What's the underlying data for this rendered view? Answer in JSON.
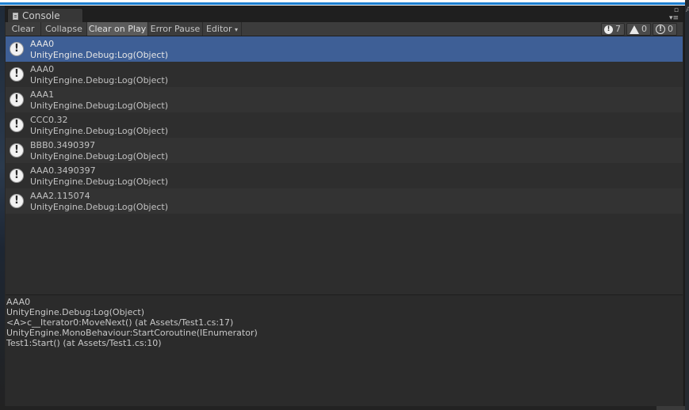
{
  "window": {
    "tab_title": "Console",
    "top_right_char": "A"
  },
  "toolbar": {
    "clear": "Clear",
    "collapse": "Collapse",
    "clear_on_play": "Clear on Play",
    "error_pause": "Error Pause",
    "editor": "Editor",
    "editor_arrow": "▾",
    "counts": {
      "errors": "7",
      "warnings": "0",
      "infos": "0"
    }
  },
  "log_entries": [
    {
      "message": "AAA0",
      "source": "UnityEngine.Debug:Log(Object)"
    },
    {
      "message": "AAA0",
      "source": "UnityEngine.Debug:Log(Object)"
    },
    {
      "message": "AAA1",
      "source": "UnityEngine.Debug:Log(Object)"
    },
    {
      "message": "CCC0.32",
      "source": "UnityEngine.Debug:Log(Object)"
    },
    {
      "message": "BBB0.3490397",
      "source": "UnityEngine.Debug:Log(Object)"
    },
    {
      "message": "AAA0.3490397",
      "source": "UnityEngine.Debug:Log(Object)"
    },
    {
      "message": "AAA2.115074",
      "source": "UnityEngine.Debug:Log(Object)"
    }
  ],
  "detail": {
    "lines": [
      "AAA0",
      "UnityEngine.Debug:Log(Object)",
      "<A>c__Iterator0:MoveNext() (at Assets/Test1.cs:17)",
      "UnityEngine.MonoBehaviour:StartCoroutine(IEnumerator)",
      "Test1:Start() (at Assets/Test1.cs:10)"
    ]
  },
  "colors": {
    "selected_row": "#3e5f96",
    "toolbar": "#3c3c3c",
    "panel": "#2d2d2d"
  }
}
